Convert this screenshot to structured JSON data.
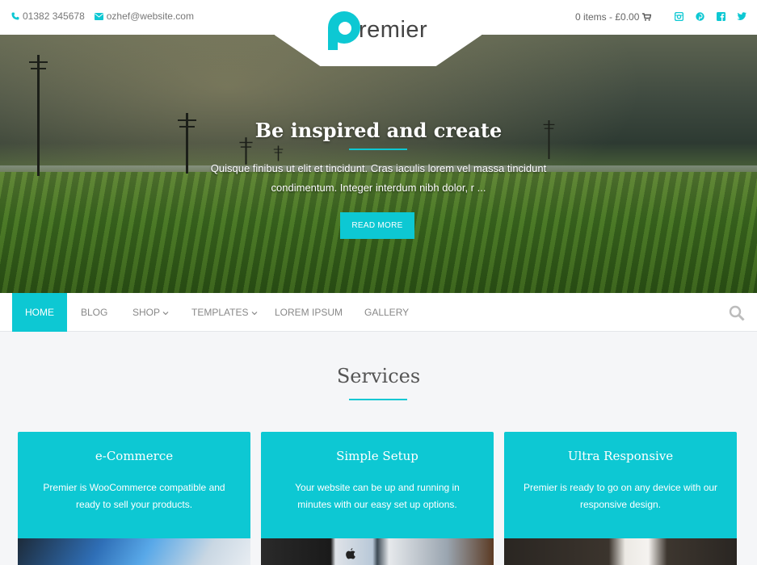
{
  "topbar": {
    "phone": "01382 345678",
    "email": "ozhef@website.com",
    "cart": "0 items - £0.00"
  },
  "logo": {
    "wordmark": "remier"
  },
  "hero": {
    "title": "Be inspired and create",
    "text": "Quisque finibus ut elit et tincidunt. Cras iaculis lorem vel massa tincidunt condimentum. Integer interdum nibh dolor, r ...",
    "button": "READ MORE"
  },
  "nav": {
    "items": [
      {
        "label": "HOME",
        "active": true
      },
      {
        "label": "BLOG"
      },
      {
        "label": "SHOP",
        "dropdown": true
      },
      {
        "label": "TEMPLATES",
        "dropdown": true
      },
      {
        "label": "LOREM IPSUM"
      },
      {
        "label": "GALLERY"
      }
    ]
  },
  "services": {
    "title": "Services",
    "cards": [
      {
        "title": "e-Commerce",
        "desc": "Premier is WooCommerce compatible and ready to sell your products."
      },
      {
        "title": "Simple Setup",
        "desc": "Your website can be up and running in minutes with our easy set up options."
      },
      {
        "title": "Ultra Responsive",
        "desc": "Premier is ready to go on any device with our responsive design."
      }
    ]
  },
  "colors": {
    "accent": "#0dc8d3",
    "text": "#555555",
    "background": "#f5f6f8"
  },
  "icons": [
    "phone-icon",
    "envelope-icon",
    "cart-icon",
    "instagram-icon",
    "pinterest-icon",
    "facebook-icon",
    "twitter-icon",
    "search-icon",
    "chevron-down-icon"
  ]
}
